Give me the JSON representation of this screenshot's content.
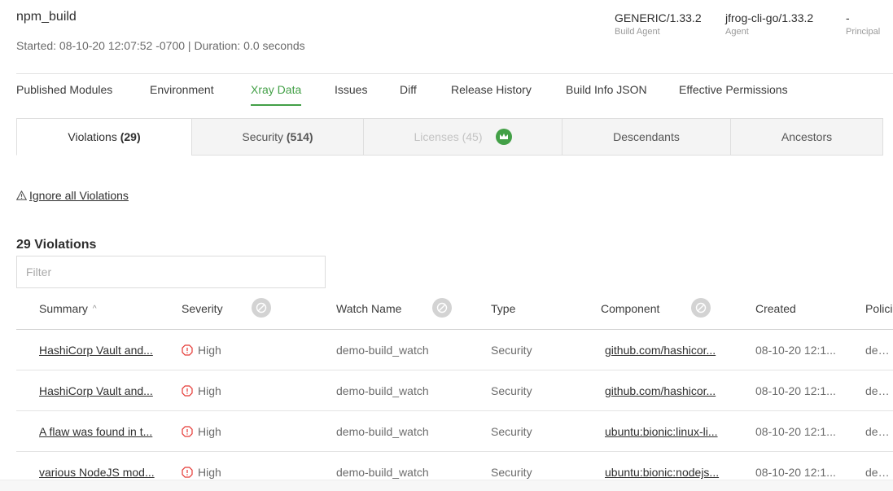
{
  "build": {
    "name": "npm_build",
    "started": "Started: 08-10-20 12:07:52 -0700 | Duration: 0.0 seconds"
  },
  "meta": [
    {
      "value": "GENERIC/1.33.2",
      "label": "Build Agent"
    },
    {
      "value": "jfrog-cli-go/1.33.2",
      "label": "Agent"
    },
    {
      "value": "-",
      "label": "Principal"
    }
  ],
  "main_tabs": [
    "Published Modules",
    "Environment",
    "Xray Data",
    "Issues",
    "Diff",
    "Release History",
    "Build Info JSON",
    "Effective Permissions"
  ],
  "active_main_tab": "Xray Data",
  "sub_tabs": [
    {
      "label": "Violations",
      "count": "(29)"
    },
    {
      "label": "Security",
      "count": "(514)"
    },
    {
      "label": "Licenses (45)",
      "count": ""
    },
    {
      "label": "Descendants",
      "count": ""
    },
    {
      "label": "Ancestors",
      "count": ""
    }
  ],
  "ignore_label": "Ignore all Violations",
  "violations_title": "29 Violations",
  "filter_placeholder": "Filter",
  "columns": [
    "Summary",
    "Severity",
    "Watch Name",
    "Type",
    "Component",
    "Created",
    "Policies"
  ],
  "rows": [
    {
      "summary": "HashiCorp Vault and...",
      "severity": "High",
      "watch": "demo-build_watch",
      "type": "Security",
      "component": "github.com/hashicor...",
      "created": "08-10-20 12:1...",
      "policy": "demo..."
    },
    {
      "summary": "HashiCorp Vault and...",
      "severity": "High",
      "watch": "demo-build_watch",
      "type": "Security",
      "component": "github.com/hashicor...",
      "created": "08-10-20 12:1...",
      "policy": "demo..."
    },
    {
      "summary": "A flaw was found in t...",
      "severity": "High",
      "watch": "demo-build_watch",
      "type": "Security",
      "component": "ubuntu:bionic:linux-li...",
      "created": "08-10-20 12:1...",
      "policy": "demo..."
    },
    {
      "summary": "various NodeJS mod...",
      "severity": "High",
      "watch": "demo-build_watch",
      "type": "Security",
      "component": "ubuntu:bionic:nodejs...",
      "created": "08-10-20 12:1...",
      "policy": "demo..."
    }
  ],
  "colors": {
    "accent": "#43a047",
    "severity_high": "#e53935"
  }
}
